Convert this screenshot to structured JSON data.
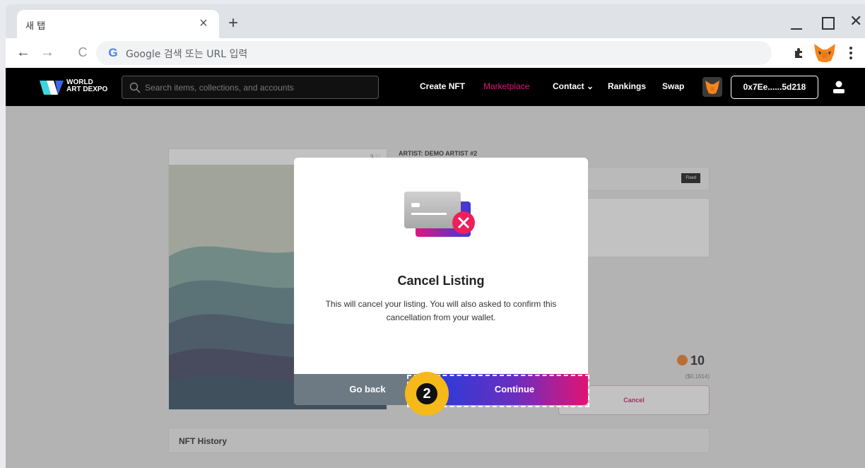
{
  "browser": {
    "tab_title": "새 탭",
    "tab_close": "×",
    "new_tab": "+",
    "window_close": "✕",
    "nav": {
      "back": "←",
      "forward": "→",
      "reload": "C"
    },
    "omnibox_logo": "G",
    "omnibox_placeholder": "Google 검색 또는 URL 입력"
  },
  "site": {
    "logo_line1": "WORLD",
    "logo_line2": "ART DEXPO",
    "search_placeholder": "Search items, collections, and accounts",
    "nav": {
      "create_nft": "Create NFT",
      "marketplace": "Marketplace",
      "contact": "Contact ⌄",
      "rankings": "Rankings",
      "swap": "Swap"
    },
    "wallet_address": "0x7Ee......5d218",
    "accent_color": "#e0157f"
  },
  "item": {
    "likes": "3 ♡",
    "artist": "ARTIST: DEMO ARTIST #2",
    "sale_type": "Fixed",
    "price": "10",
    "price_usd": "($0.1614)",
    "cancel_label": "Cancel",
    "history_title": "NFT History"
  },
  "modal": {
    "title": "Cancel Listing",
    "body": "This will cancel your listing. You will also asked to confirm this cancellation from your wallet.",
    "back_label": "Go back",
    "continue_label": "Continue"
  },
  "annotation": {
    "step": "2",
    "badge_color": "#f5b919"
  }
}
